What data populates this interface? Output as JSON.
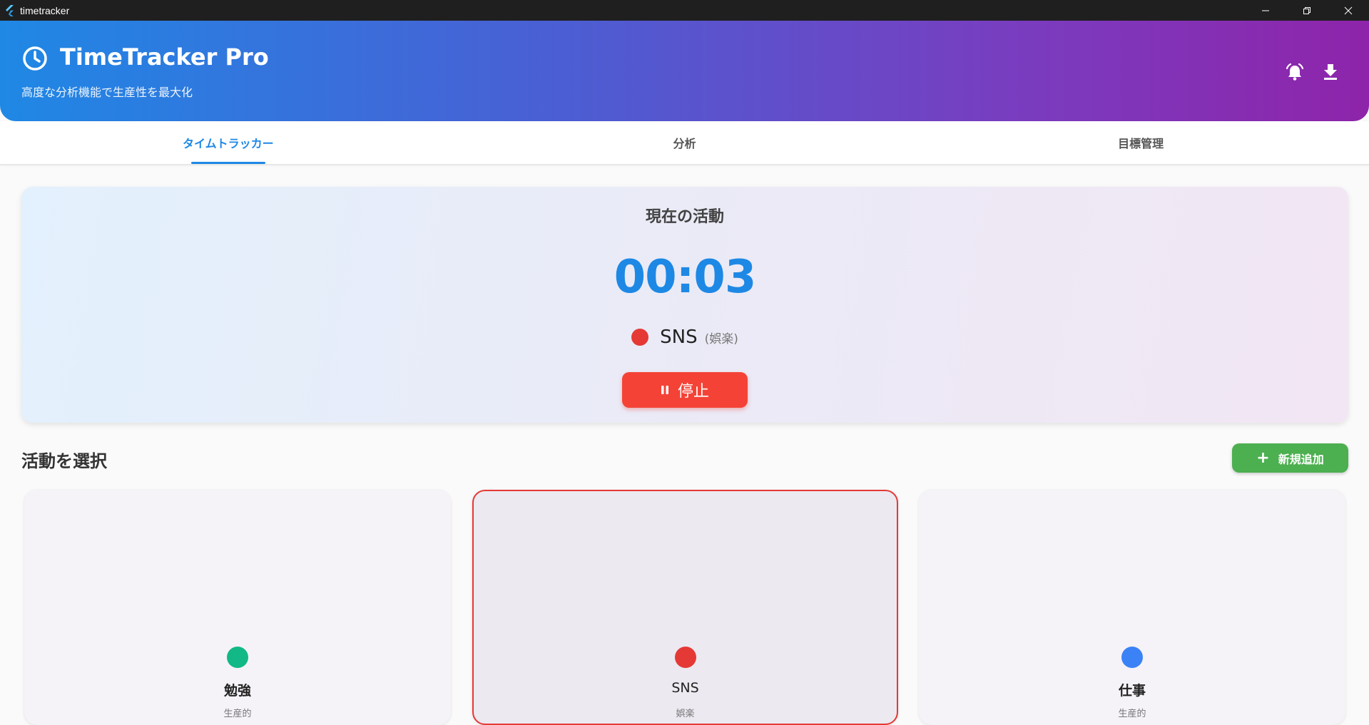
{
  "window": {
    "title": "timetracker",
    "icon": "flutter-icon",
    "controls": [
      "minimize-icon",
      "restore-icon",
      "close-icon"
    ]
  },
  "header": {
    "title": "TimeTracker Pro",
    "subtitle": "高度な分析機能で生産性を最大化",
    "icons": [
      "clock-icon",
      "alarm-icon",
      "download-icon"
    ],
    "gradient": [
      "#1f88e5",
      "#8e24aa"
    ]
  },
  "tabs": [
    {
      "label": "タイムトラッカー",
      "active": true
    },
    {
      "label": "分析",
      "active": false
    },
    {
      "label": "目標管理",
      "active": false
    }
  ],
  "current": {
    "heading": "現在の活動",
    "timer": "00:03",
    "activity_name": "SNS",
    "activity_category": "(娯楽)",
    "activity_color": "#e53935",
    "stop_label": "停止"
  },
  "select_section": {
    "title": "活動を選択",
    "add_label": "新規追加"
  },
  "activities": [
    {
      "name": "勉強",
      "category": "生産的",
      "color": "#12b886",
      "selected": false
    },
    {
      "name": "SNS",
      "category": "娯楽",
      "color": "#e53935",
      "selected": true
    },
    {
      "name": "仕事",
      "category": "生産的",
      "color": "#3b82f6",
      "selected": false
    }
  ],
  "colors": {
    "accent": "#1e88e5",
    "stop": "#f44336",
    "add": "#4caf50"
  }
}
